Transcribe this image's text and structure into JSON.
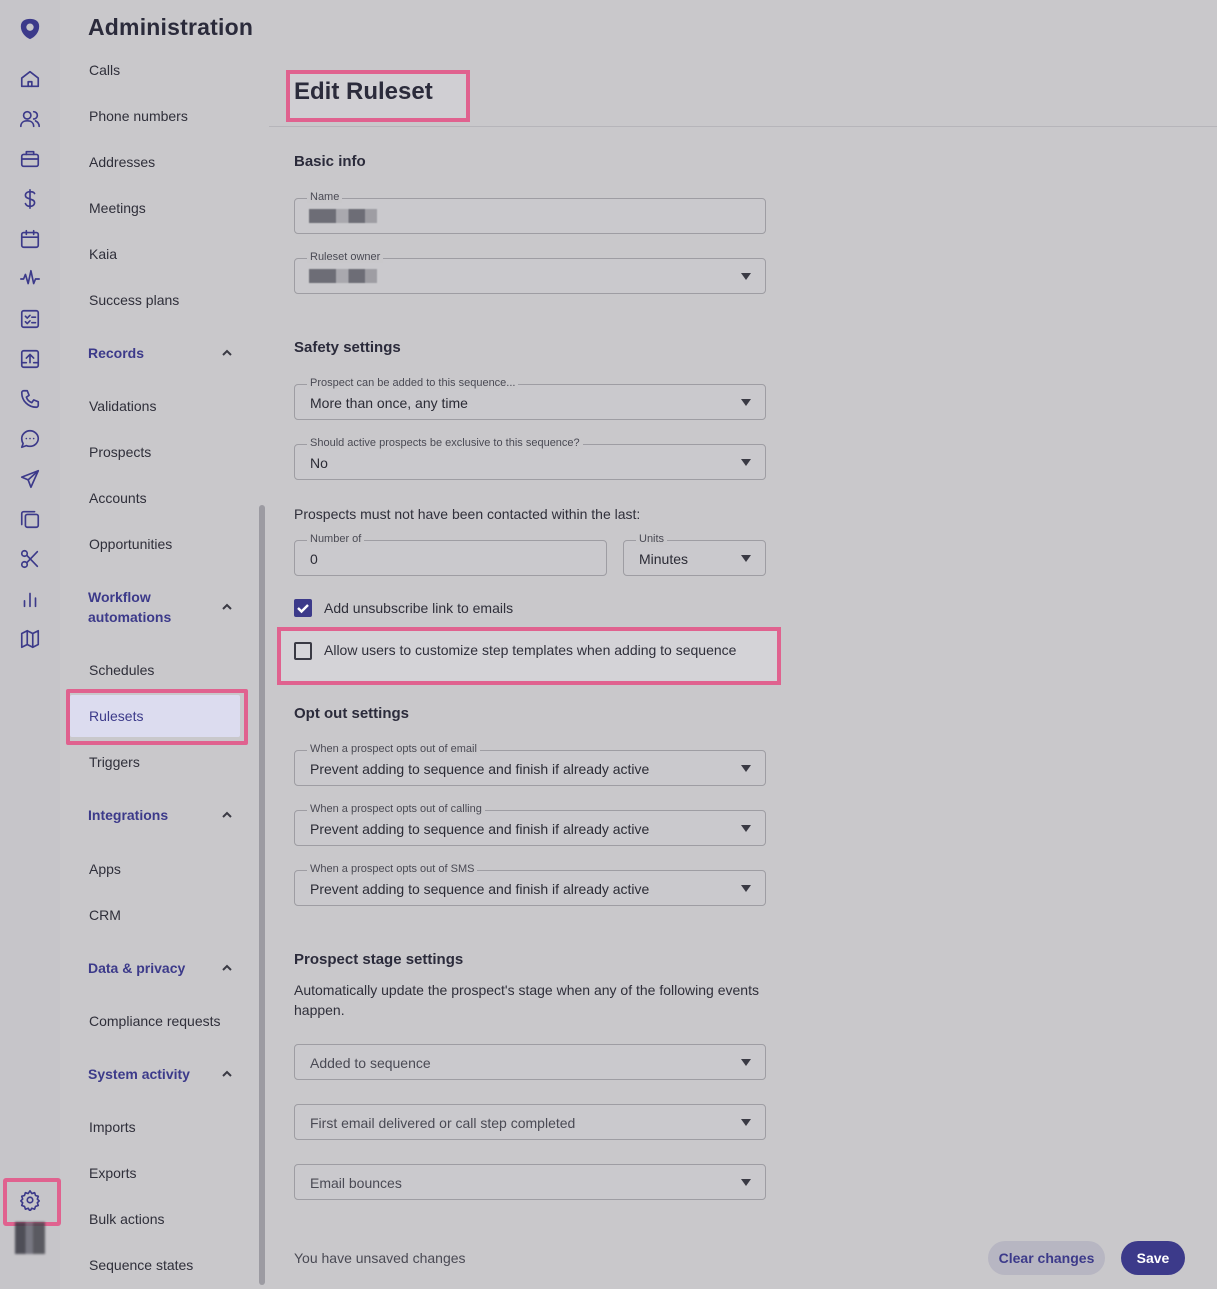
{
  "admin": {
    "title": "Administration"
  },
  "nav": {
    "items_top": [
      "Calls",
      "Phone numbers",
      "Addresses",
      "Meetings",
      "Kaia",
      "Success plans"
    ],
    "records": {
      "label": "Records",
      "items": [
        "Validations",
        "Prospects",
        "Accounts",
        "Opportunities"
      ]
    },
    "workflow": {
      "label_line1": "Workflow",
      "label_line2": "automations",
      "items": [
        "Schedules",
        "Rulesets",
        "Triggers"
      ]
    },
    "integrations": {
      "label": "Integrations",
      "items": [
        "Apps",
        "CRM"
      ]
    },
    "data_privacy": {
      "label": "Data & privacy",
      "items": [
        "Compliance requests"
      ]
    },
    "system_activity": {
      "label": "System activity",
      "items": [
        "Imports",
        "Exports",
        "Bulk actions",
        "Sequence states"
      ]
    }
  },
  "rail": {
    "icons": [
      "logo-icon",
      "home-icon",
      "users-icon",
      "briefcase-icon",
      "dollar-icon",
      "calendar-icon",
      "waveform-icon",
      "checklist-icon",
      "upload-icon",
      "phone-icon",
      "chat-icon",
      "send-icon",
      "copy-icon",
      "scissors-icon",
      "bar-chart-icon",
      "map-icon",
      "gear-icon"
    ]
  },
  "page": {
    "title": "Edit Ruleset"
  },
  "basic": {
    "heading": "Basic info",
    "name_label": "Name",
    "owner_label": "Ruleset owner"
  },
  "safety": {
    "heading": "Safety settings",
    "added_label": "Prospect can be added to this sequence...",
    "added_value": "More than once, any time",
    "exclusive_label": "Should active prospects be exclusive to this sequence?",
    "exclusive_value": "No",
    "contacted_text": "Prospects must not have been contacted within the last:",
    "number_label": "Number of",
    "number_value": "0",
    "units_label": "Units",
    "units_value": "Minutes",
    "unsubscribe_label": "Add unsubscribe link to emails",
    "unsubscribe_checked": true,
    "customize_label": "Allow users to customize step templates when adding to sequence",
    "customize_checked": false
  },
  "optout": {
    "heading": "Opt out settings",
    "email_label": "When a prospect opts out of email",
    "email_value": "Prevent adding to sequence and finish if already active",
    "calling_label": "When a prospect opts out of calling",
    "calling_value": "Prevent adding to sequence and finish if already active",
    "sms_label": "When a prospect opts out of SMS",
    "sms_value": "Prevent adding to sequence and finish if already active"
  },
  "stage": {
    "heading": "Prospect stage settings",
    "description_line1": "Automatically update the prospect's stage when any of the following events",
    "description_line2": "happen.",
    "events": [
      "Added to sequence",
      "First email delivered or call step completed",
      "Email bounces"
    ]
  },
  "footer": {
    "unsaved": "You have unsaved changes",
    "clear": "Clear changes",
    "save": "Save"
  },
  "colors": {
    "accent": "#3c3a8a",
    "highlight": "#e0628f"
  }
}
